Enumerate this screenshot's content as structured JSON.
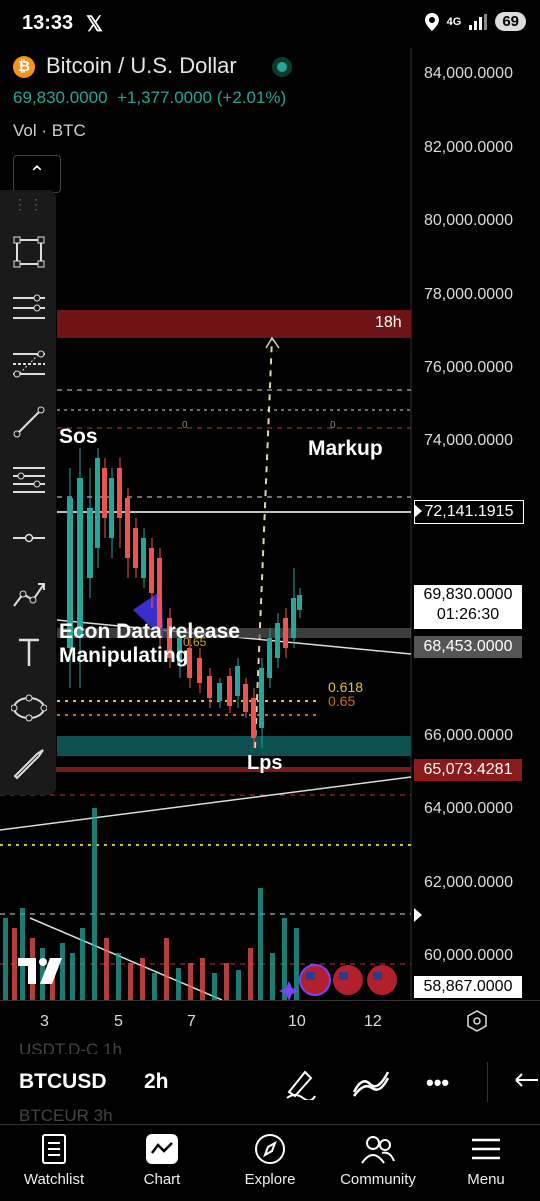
{
  "status_bar": {
    "time": "13:33",
    "x_glyph": "𝕏",
    "network": "4G",
    "battery": "69"
  },
  "header": {
    "pair_title": "Bitcoin / U.S. Dollar",
    "coin_glyph": "₿",
    "price": "69,830.0000",
    "change": "+1,377.0000 (+2.01%)",
    "volume_label": "Vol · BTC",
    "collapse_glyph": "⌃"
  },
  "price_axis": {
    "labels": [
      "84,000.0000",
      "82,000.0000",
      "80,000.0000",
      "78,000.0000",
      "76,000.0000",
      "74,000.0000",
      "72,141.1915",
      "69,830.0000",
      "01:26:30",
      "68,453.0000",
      "66,000.0000",
      "65,073.4281",
      "64,000.0000",
      "62,000.0000",
      "60,000.0000",
      "58,867.0000"
    ]
  },
  "chart_annotations": {
    "resistance_label": "18h",
    "sos": "Sos",
    "markup": "Markup",
    "econ": "Econ Data release",
    "manipulating": "Manipulating",
    "lps": "Lps",
    "fib_618": "0.618",
    "fib_65": "0.65",
    "fib_small": "0.65"
  },
  "time_axis": {
    "labels": [
      "3",
      "5",
      "7",
      "10",
      "12"
    ]
  },
  "symbol_bar": {
    "prev": "USDT.D-C   1h",
    "symbol": "BTCUSD",
    "interval": "2h",
    "next": "BTCEUR   3h",
    "more_glyph": "•••"
  },
  "bottom_nav": [
    {
      "label": "Watchlist",
      "icon": "watchlist-icon"
    },
    {
      "label": "Chart",
      "icon": "chart-icon"
    },
    {
      "label": "Explore",
      "icon": "compass-icon"
    },
    {
      "label": "Community",
      "icon": "people-icon"
    },
    {
      "label": "Menu",
      "icon": "menu-icon"
    }
  ],
  "colors": {
    "up": "#26a69a",
    "down": "#ef5350",
    "resistance": "#8b1a1a",
    "support": "#0e5a5a"
  }
}
